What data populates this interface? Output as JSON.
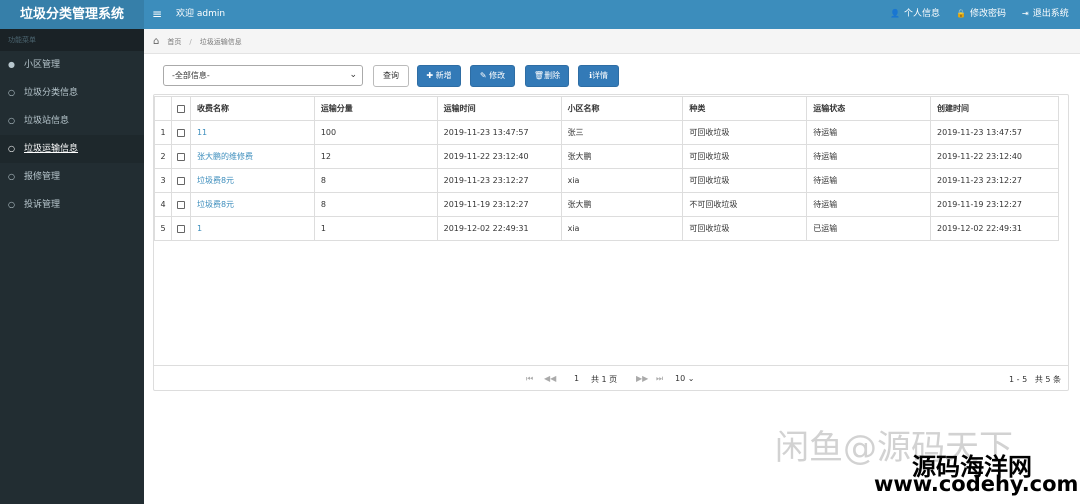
{
  "app": {
    "title": "垃圾分类管理系统",
    "welcome": "欢迎 admin"
  },
  "topnav": {
    "profile": "个人信息",
    "password": "修改密码",
    "logout": "退出系统"
  },
  "sidebar": {
    "header": "功能菜单",
    "items": [
      {
        "label": "小区管理",
        "icon": "user-icon"
      },
      {
        "label": "垃圾分类信息",
        "icon": "circle-icon"
      },
      {
        "label": "垃圾站信息",
        "icon": "circle-icon"
      },
      {
        "label": "垃圾运输信息",
        "icon": "circle-icon"
      },
      {
        "label": "报修管理",
        "icon": "circle-icon"
      },
      {
        "label": "投诉管理",
        "icon": "circle-icon"
      }
    ]
  },
  "breadcrumb": {
    "home": "首页",
    "current": "垃圾运输信息"
  },
  "toolbar": {
    "filter_value": "-全部信息-",
    "query": "查询",
    "add": "新增",
    "edit": "修改",
    "delete": "删除",
    "detail": "详情"
  },
  "table": {
    "columns": [
      "收费名称",
      "运输分量",
      "运输时间",
      "小区名称",
      "种类",
      "运输状态",
      "创建时间"
    ],
    "rows": [
      {
        "num": "1",
        "name": "11",
        "qty": "100",
        "time": "2019-11-23 13:47:57",
        "community": "张三",
        "kind": "可回收垃圾",
        "status": "待运输",
        "created": "2019-11-23 13:47:57"
      },
      {
        "num": "2",
        "name": "张大鹏的维修费",
        "qty": "12",
        "time": "2019-11-22 23:12:40",
        "community": "张大鹏",
        "kind": "可回收垃圾",
        "status": "待运输",
        "created": "2019-11-22 23:12:40"
      },
      {
        "num": "3",
        "name": "垃圾费8元",
        "qty": "8",
        "time": "2019-11-23 23:12:27",
        "community": "xia",
        "kind": "可回收垃圾",
        "status": "待运输",
        "created": "2019-11-23 23:12:27"
      },
      {
        "num": "4",
        "name": "垃圾费8元",
        "qty": "8",
        "time": "2019-11-19 23:12:27",
        "community": "张大鹏",
        "kind": "不可回收垃圾",
        "status": "待运输",
        "created": "2019-11-19 23:12:27"
      },
      {
        "num": "5",
        "name": "1",
        "qty": "1",
        "time": "2019-12-02 22:49:31",
        "community": "xia",
        "kind": "可回收垃圾",
        "status": "已运输",
        "created": "2019-12-02 22:49:31"
      }
    ]
  },
  "pager": {
    "page": "1",
    "total_pages": "共 1 页",
    "page_size": "10",
    "range": "1 - 5",
    "total": "共 5 条"
  },
  "watermark": {
    "line1": "闲鱼@源码天下",
    "line2": "源码海洋网",
    "line3": "www.codehy.com"
  }
}
